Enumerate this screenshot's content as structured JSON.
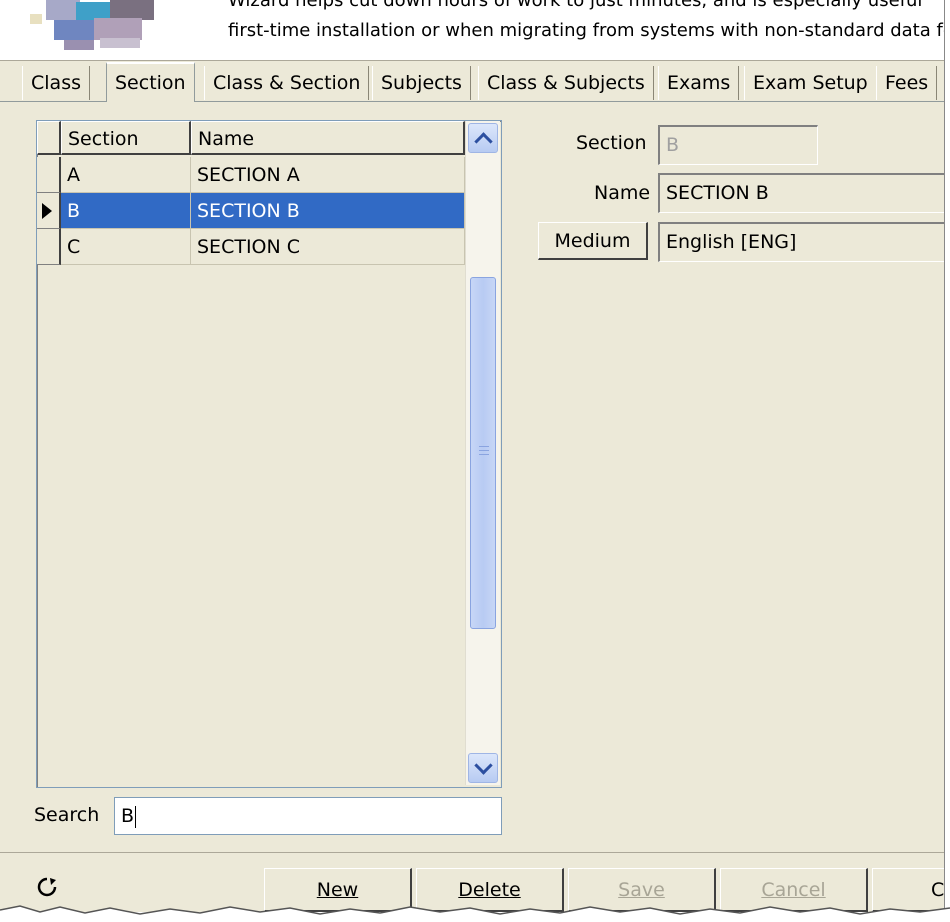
{
  "header": {
    "line1": "Wizard helps cut down hours of work to just minutes, and is especially useful",
    "line2": "first-time installation or when migrating from systems with non-standard data fo"
  },
  "tabs": [
    {
      "label": "Class"
    },
    {
      "label": "Section"
    },
    {
      "label": "Class & Section"
    },
    {
      "label": "Subjects"
    },
    {
      "label": "Class & Subjects"
    },
    {
      "label": "Exams"
    },
    {
      "label": "Exam Setup"
    },
    {
      "label": "Fees"
    }
  ],
  "grid": {
    "columns": [
      "Section",
      "Name"
    ],
    "rows": [
      {
        "section": "A",
        "name": "SECTION A"
      },
      {
        "section": "B",
        "name": "SECTION B"
      },
      {
        "section": "C",
        "name": "SECTION C"
      }
    ],
    "selected_index": 1
  },
  "detail": {
    "section_label": "Section",
    "section_value": "B",
    "name_label": "Name",
    "name_value": "SECTION B",
    "medium_button": "Medium",
    "medium_value": "English [ENG]"
  },
  "search": {
    "label": "Search",
    "value": "B"
  },
  "buttons": {
    "new": "New",
    "delete": "Delete",
    "save": "Save",
    "cancel": "Cancel",
    "close": "Clo"
  },
  "colors": {
    "window_bg": "#ece9d8",
    "selection": "#316ac5"
  }
}
